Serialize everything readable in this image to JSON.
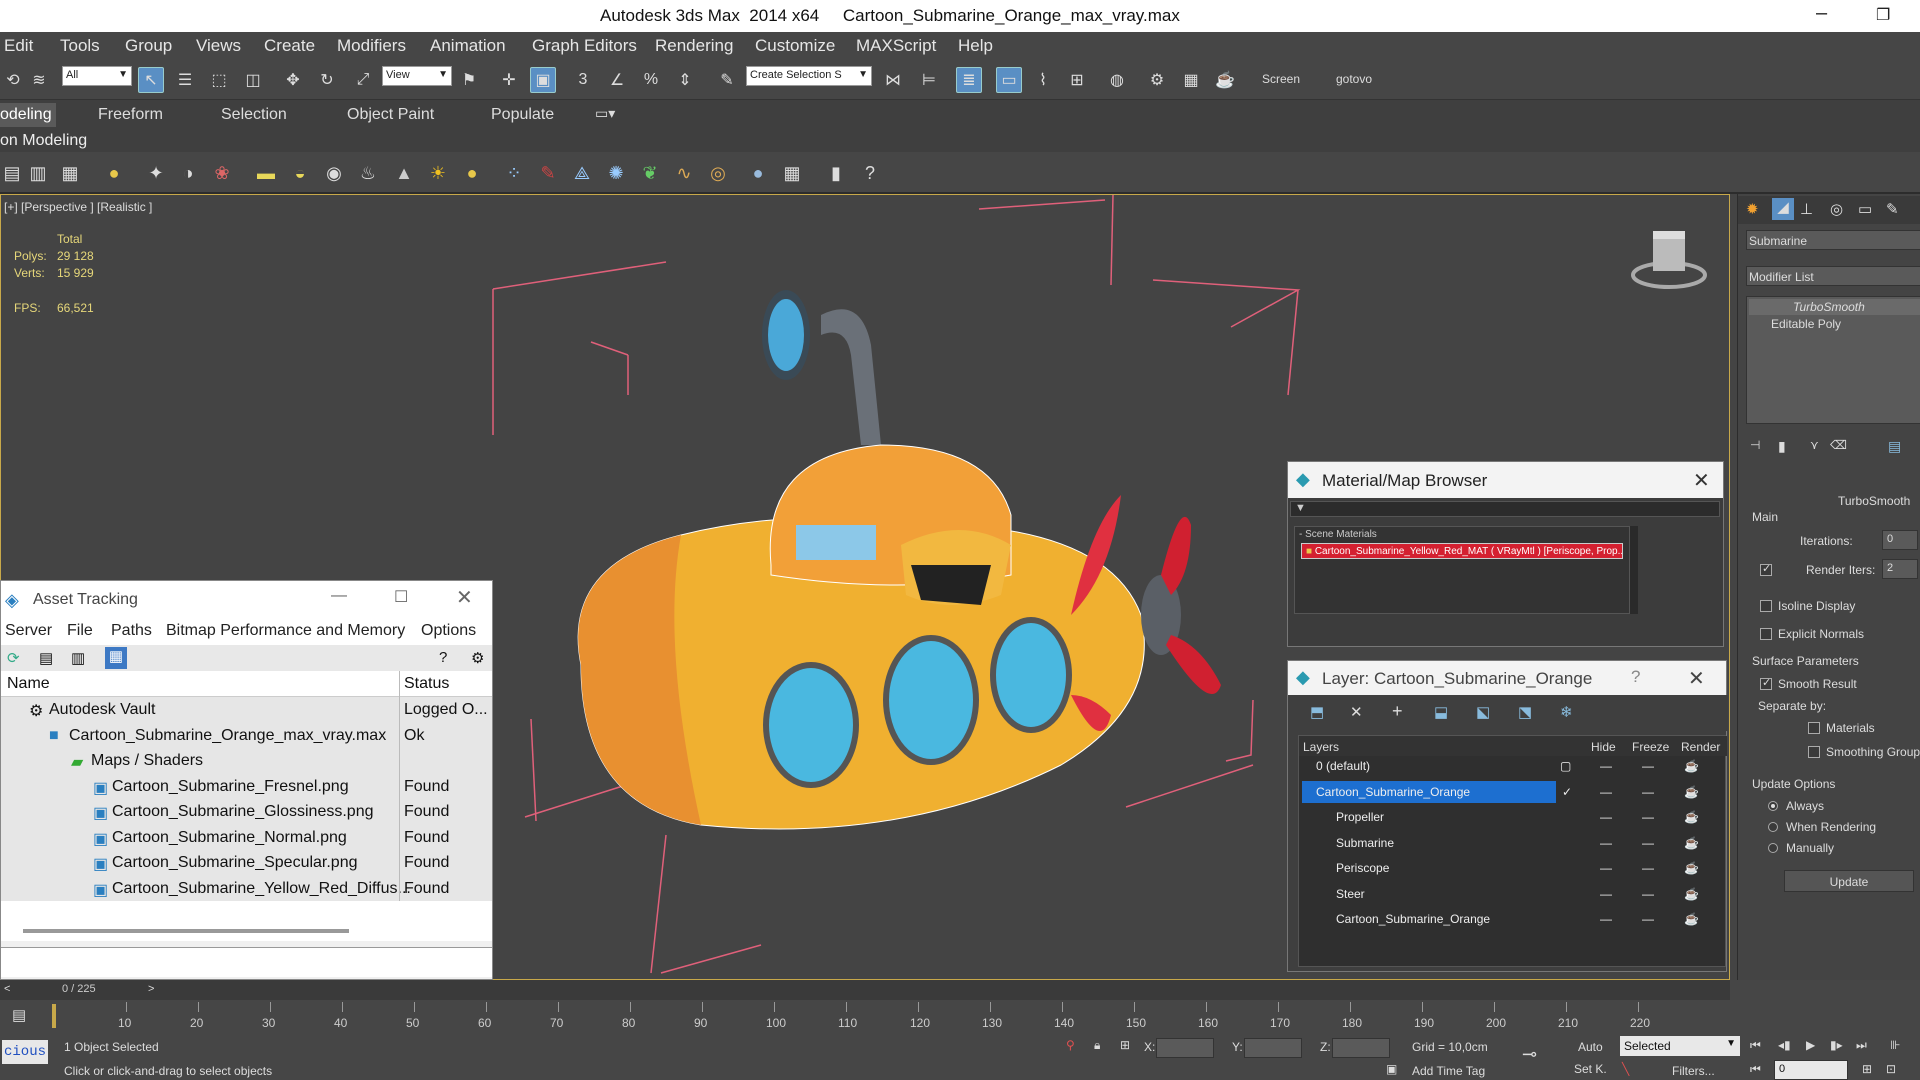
{
  "window": {
    "title": "Autodesk 3ds Max  2014 x64     Cartoon_Submarine_Orange_max_vray.max"
  },
  "menu": [
    "Edit",
    "Tools",
    "Group",
    "Views",
    "Create",
    "Modifiers",
    "Animation",
    "Graph Editors",
    "Rendering",
    "Customize",
    "MAXScript",
    "Help"
  ],
  "toolbar": {
    "filter": "All",
    "view": "View",
    "selection_set": "Create Selection S",
    "screen_label": "Screen",
    "gotovo_label": "gotovo"
  },
  "ribbon": {
    "tabs": [
      "odeling",
      "Freeform",
      "Selection",
      "Object Paint",
      "Populate"
    ],
    "sub": "on Modeling"
  },
  "viewport": {
    "label": "[+] [Perspective ] [Realistic ]",
    "stats": {
      "total": "Total",
      "polys_label": "Polys:",
      "polys": "29 128",
      "verts_label": "Verts:",
      "verts": "15 929",
      "fps_label": "FPS:",
      "fps": "66,521"
    }
  },
  "asset_tracking": {
    "title": "Asset Tracking",
    "menu": [
      "Server",
      "File",
      "Paths",
      "Bitmap Performance and Memory",
      "Options"
    ],
    "col_name": "Name",
    "col_status": "Status",
    "rows": [
      {
        "name": "Autodesk Vault",
        "status": "Logged O..."
      },
      {
        "name": "Cartoon_Submarine_Orange_max_vray.max",
        "status": "Ok"
      },
      {
        "name": "Maps / Shaders",
        "status": ""
      },
      {
        "name": "Cartoon_Submarine_Fresnel.png",
        "status": "Found"
      },
      {
        "name": "Cartoon_Submarine_Glossiness.png",
        "status": "Found"
      },
      {
        "name": "Cartoon_Submarine_Normal.png",
        "status": "Found"
      },
      {
        "name": "Cartoon_Submarine_Specular.png",
        "status": "Found"
      },
      {
        "name": "Cartoon_Submarine_Yellow_Red_Diffus...",
        "status": "Found"
      }
    ]
  },
  "material_browser": {
    "title": "Material/Map Browser",
    "group": "- Scene Materials",
    "item": "Cartoon_Submarine_Yellow_Red_MAT ( VRayMtl ) [Periscope, Prop..."
  },
  "layer_manager": {
    "title": "Layer: Cartoon_Submarine_Orange",
    "cols": {
      "layers": "Layers",
      "hide": "Hide",
      "freeze": "Freeze",
      "render": "Render"
    },
    "rows": [
      "0 (default)",
      "Cartoon_Submarine_Orange",
      "Propeller",
      "Submarine",
      "Periscope",
      "Steer",
      "Cartoon_Submarine_Orange"
    ]
  },
  "command_panel": {
    "object_name": "Submarine",
    "modifier_list": "Modifier List",
    "stack": [
      "TurboSmooth",
      "Editable Poly"
    ],
    "turbosmooth": "TurboSmooth",
    "main": "Main",
    "iterations_label": "Iterations:",
    "iterations": "0",
    "render_iters_label": "Render Iters:",
    "render_iters": "2",
    "isoline": "Isoline Display",
    "explicit": "Explicit Normals",
    "surface": "Surface Parameters",
    "smooth_result": "Smooth Result",
    "separate": "Separate by:",
    "materials": "Materials",
    "smoothing": "Smoothing Groups",
    "update_options": "Update Options",
    "always": "Always",
    "when_rendering": "When Rendering",
    "manually": "Manually",
    "update_btn": "Update"
  },
  "timeline": {
    "frame": "0 / 225",
    "ticks": [
      "10",
      "20",
      "30",
      "40",
      "50",
      "60",
      "70",
      "80",
      "90",
      "100",
      "110",
      "120",
      "130",
      "140",
      "150",
      "160",
      "170",
      "180",
      "190",
      "200",
      "210",
      "220"
    ]
  },
  "status": {
    "selected": "1 Object Selected",
    "prompt": "Click or click-and-drag to select objects",
    "x": "X:",
    "y": "Y:",
    "z": "Z:",
    "grid": "Grid = 10,0cm",
    "addtag": "Add Time Tag",
    "auto": "Auto",
    "setk": "Set K.",
    "mode": "Selected",
    "filters": "Filters...",
    "frame_val": "0",
    "script": "cious"
  }
}
